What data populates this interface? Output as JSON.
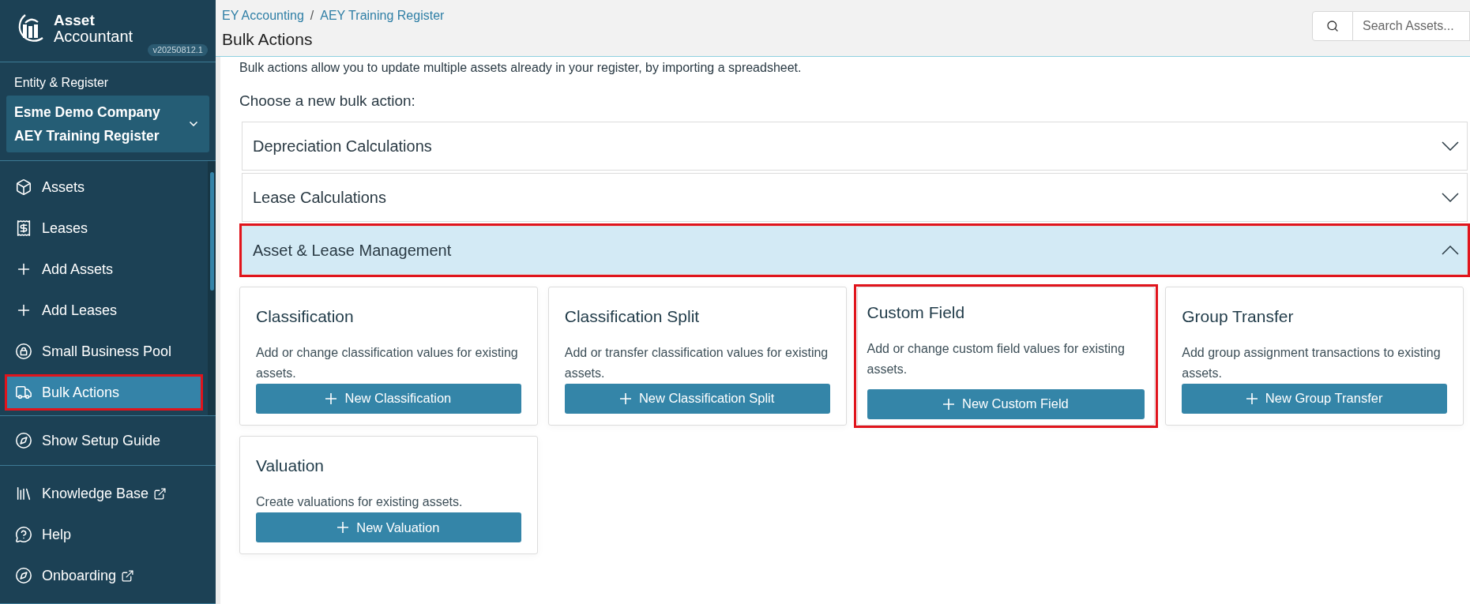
{
  "brand": {
    "line1": "Asset",
    "line2": "Accountant",
    "version": "v20250812.1"
  },
  "sidebar": {
    "entity_label": "Entity & Register",
    "entity": [
      "Esme Demo Company",
      "AEY Training Register"
    ],
    "nav": [
      {
        "label": "Assets",
        "kind": "box",
        "selected": false,
        "highlighted": false
      },
      {
        "label": "Leases",
        "kind": "receipt",
        "selected": false,
        "highlighted": false
      },
      {
        "label": "Add Assets",
        "kind": "plus",
        "selected": false,
        "highlighted": false
      },
      {
        "label": "Add Leases",
        "kind": "plus",
        "selected": false,
        "highlighted": false
      },
      {
        "label": "Small Business Pool",
        "kind": "pool",
        "selected": false,
        "highlighted": false
      },
      {
        "label": "Bulk Actions",
        "kind": "truck",
        "selected": true,
        "highlighted": true
      }
    ],
    "setup": {
      "label": "Show Setup Guide",
      "kind": "compass",
      "external": false
    },
    "links": [
      {
        "label": "Knowledge Base",
        "kind": "books",
        "external": true
      },
      {
        "label": "Help",
        "kind": "help",
        "external": false
      },
      {
        "label": "Onboarding",
        "kind": "compass",
        "external": true
      }
    ]
  },
  "header": {
    "breadcrumbs": [
      "EY Accounting",
      "AEY Training Register"
    ],
    "separator": "/",
    "title": "Bulk Actions",
    "search": {
      "placeholder": "Search Assets..."
    }
  },
  "intro": "Bulk actions allow you to update multiple assets already in your register, by importing a spreadsheet.",
  "prompt": "Choose a new bulk action:",
  "sections": [
    {
      "title": "Depreciation Calculations",
      "expanded": false,
      "highlighted": false
    },
    {
      "title": "Lease Calculations",
      "expanded": false,
      "highlighted": false
    },
    {
      "title": "Asset & Lease Management",
      "expanded": true,
      "highlighted": true,
      "cards": [
        {
          "title": "Classification",
          "description": "Add or change classification values for existing assets.",
          "button": "New Classification",
          "highlighted": false
        },
        {
          "title": "Classification Split",
          "description": "Add or transfer classification values for existing assets.",
          "button": "New Classification Split",
          "highlighted": false
        },
        {
          "title": "Custom Field",
          "description": "Add or change custom field values for existing assets.",
          "button": "New Custom Field",
          "highlighted": true
        },
        {
          "title": "Group Transfer",
          "description": "Add group assignment transactions to existing assets.",
          "button": "New Group Transfer",
          "highlighted": false
        },
        {
          "title": "Valuation",
          "description": "Create valuations for existing assets.",
          "button": "New Valuation",
          "highlighted": false
        }
      ]
    }
  ]
}
